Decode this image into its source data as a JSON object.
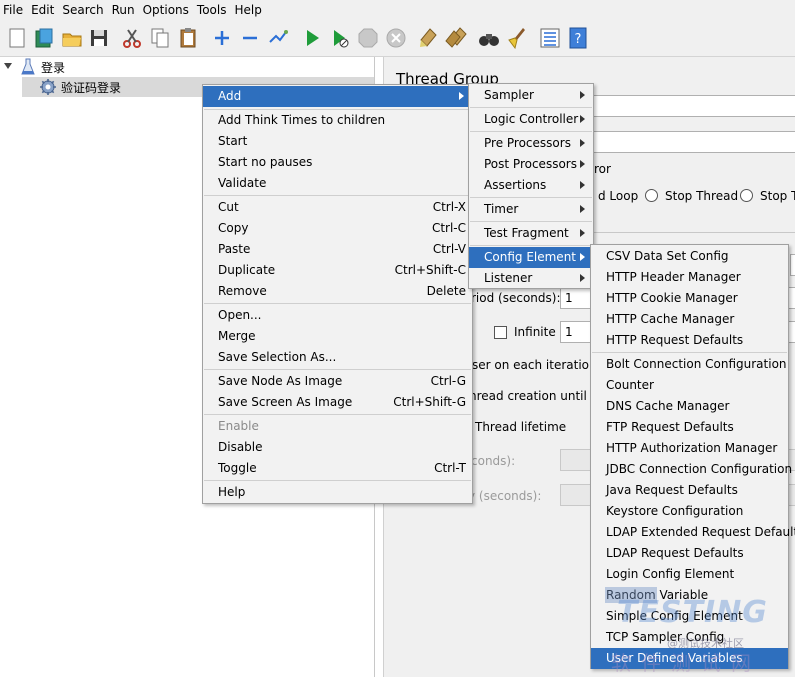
{
  "menubar": {
    "items": [
      "File",
      "Edit",
      "Search",
      "Run",
      "Options",
      "Tools",
      "Help"
    ]
  },
  "toolbar": {
    "icons": [
      "new-icon",
      "templates-icon",
      "open-icon",
      "save-icon",
      "cut-icon",
      "copy-icon",
      "paste-icon",
      "expand-icon",
      "collapse-icon",
      "toggle-icon",
      "start-icon",
      "start-no-pauses-icon",
      "stop-icon",
      "shutdown-icon",
      "clear-icon",
      "clear-all-icon",
      "search-icon",
      "reset-search-icon",
      "function-helper-icon",
      "help-icon"
    ]
  },
  "tree": {
    "root_label": "登录",
    "child_label": "验证码登录"
  },
  "right_panel": {
    "title": "Thread Group",
    "error_action_fragment": "ror",
    "loop_fragment": "d Loop",
    "stop_thread": "Stop Thread",
    "stop_test_fragment": "Stop Te",
    "ramp_up_label_fragment": "riod (seconds):",
    "ramp_up_value": "1",
    "infinite_label": "Infinite",
    "loop_value": "1",
    "same_user_fragment": "ser on each iteration",
    "delay_creation_fragment": "hread creation until ne",
    "specify_lifetime_fragment": "Thread lifetime",
    "duration_fragment": "conds):",
    "startup_delay_fragment": "y (seconds):"
  },
  "context_menu": {
    "items": [
      {
        "label": "Add",
        "accel": "",
        "submenu": true,
        "highlighted": true
      },
      {
        "label": "Add Think Times to children",
        "accel": ""
      },
      {
        "label": "Start",
        "accel": ""
      },
      {
        "label": "Start no pauses",
        "accel": ""
      },
      {
        "label": "Validate",
        "accel": ""
      },
      {
        "label": "Cut",
        "accel": "Ctrl-X"
      },
      {
        "label": "Copy",
        "accel": "Ctrl-C"
      },
      {
        "label": "Paste",
        "accel": "Ctrl-V"
      },
      {
        "label": "Duplicate",
        "accel": "Ctrl+Shift-C"
      },
      {
        "label": "Remove",
        "accel": "Delete"
      },
      {
        "label": "Open...",
        "accel": ""
      },
      {
        "label": "Merge",
        "accel": ""
      },
      {
        "label": "Save Selection As...",
        "accel": ""
      },
      {
        "label": "Save Node As Image",
        "accel": "Ctrl-G"
      },
      {
        "label": "Save Screen As Image",
        "accel": "Ctrl+Shift-G"
      },
      {
        "label": "Enable",
        "accel": "",
        "disabled": true
      },
      {
        "label": "Disable",
        "accel": ""
      },
      {
        "label": "Toggle",
        "accel": "Ctrl-T"
      },
      {
        "label": "Help",
        "accel": ""
      }
    ]
  },
  "add_submenu": {
    "items": [
      {
        "label": "Sampler"
      },
      {
        "label": "Logic Controller"
      },
      {
        "label": "Pre Processors"
      },
      {
        "label": "Post Processors"
      },
      {
        "label": "Assertions"
      },
      {
        "label": "Timer"
      },
      {
        "label": "Test Fragment"
      },
      {
        "label": "Config Element",
        "highlighted": true
      },
      {
        "label": "Listener"
      }
    ]
  },
  "config_submenu": {
    "items": [
      {
        "label": "CSV Data Set Config"
      },
      {
        "label": "HTTP Header Manager"
      },
      {
        "label": "HTTP Cookie Manager"
      },
      {
        "label": "HTTP Cache Manager"
      },
      {
        "label": "HTTP Request Defaults"
      },
      {
        "label": "Bolt Connection Configuration"
      },
      {
        "label": "Counter"
      },
      {
        "label": "DNS Cache Manager"
      },
      {
        "label": "FTP Request Defaults"
      },
      {
        "label": "HTTP Authorization Manager"
      },
      {
        "label": "JDBC Connection Configuration"
      },
      {
        "label": "Java Request Defaults"
      },
      {
        "label": "Keystore Configuration"
      },
      {
        "label": "LDAP Extended Request Defaults"
      },
      {
        "label": "LDAP Request Defaults"
      },
      {
        "label": "Login Config Element"
      },
      {
        "label": "Random Variable"
      },
      {
        "label": "Simple Config Element"
      },
      {
        "label": "TCP Sampler Config"
      },
      {
        "label": "User Defined Variables",
        "highlighted": true
      }
    ]
  },
  "watermark": {
    "brand": "TESTING",
    "subtitle": "@测试技术社区",
    "chinese": "软件测试网"
  },
  "colors": {
    "highlight": "#2e6fbe",
    "menu_bg": "#f2f2f2",
    "panel_bg": "#f0f0f0"
  }
}
